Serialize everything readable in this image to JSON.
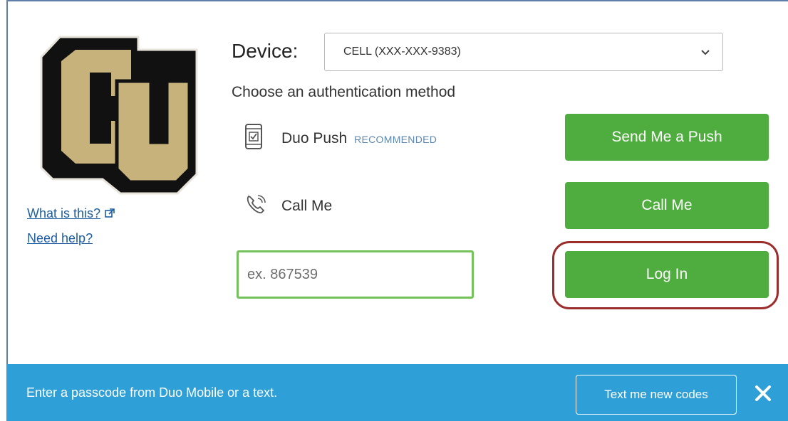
{
  "sidebar": {
    "logo_alt": "CU logo",
    "what_is_this": "What is this?",
    "need_help": "Need help?"
  },
  "device": {
    "label": "Device:",
    "selected": "CELL (XXX-XXX-9383)"
  },
  "methods": {
    "title": "Choose an authentication method",
    "push": {
      "label": "Duo Push",
      "tag": "RECOMMENDED",
      "button": "Send Me a Push"
    },
    "call": {
      "label": "Call Me",
      "button": "Call Me"
    },
    "passcode": {
      "placeholder": "ex. 867539",
      "button": "Log In"
    }
  },
  "footer": {
    "message": "Enter a passcode from Duo Mobile or a text.",
    "text_codes_button": "Text me new codes",
    "close_icon": "close-icon"
  },
  "colors": {
    "primary_green": "#4fad3f",
    "info_blue": "#2f9fd8",
    "highlight_red": "#9b2d2d",
    "logo_gold": "#c8b27c"
  }
}
